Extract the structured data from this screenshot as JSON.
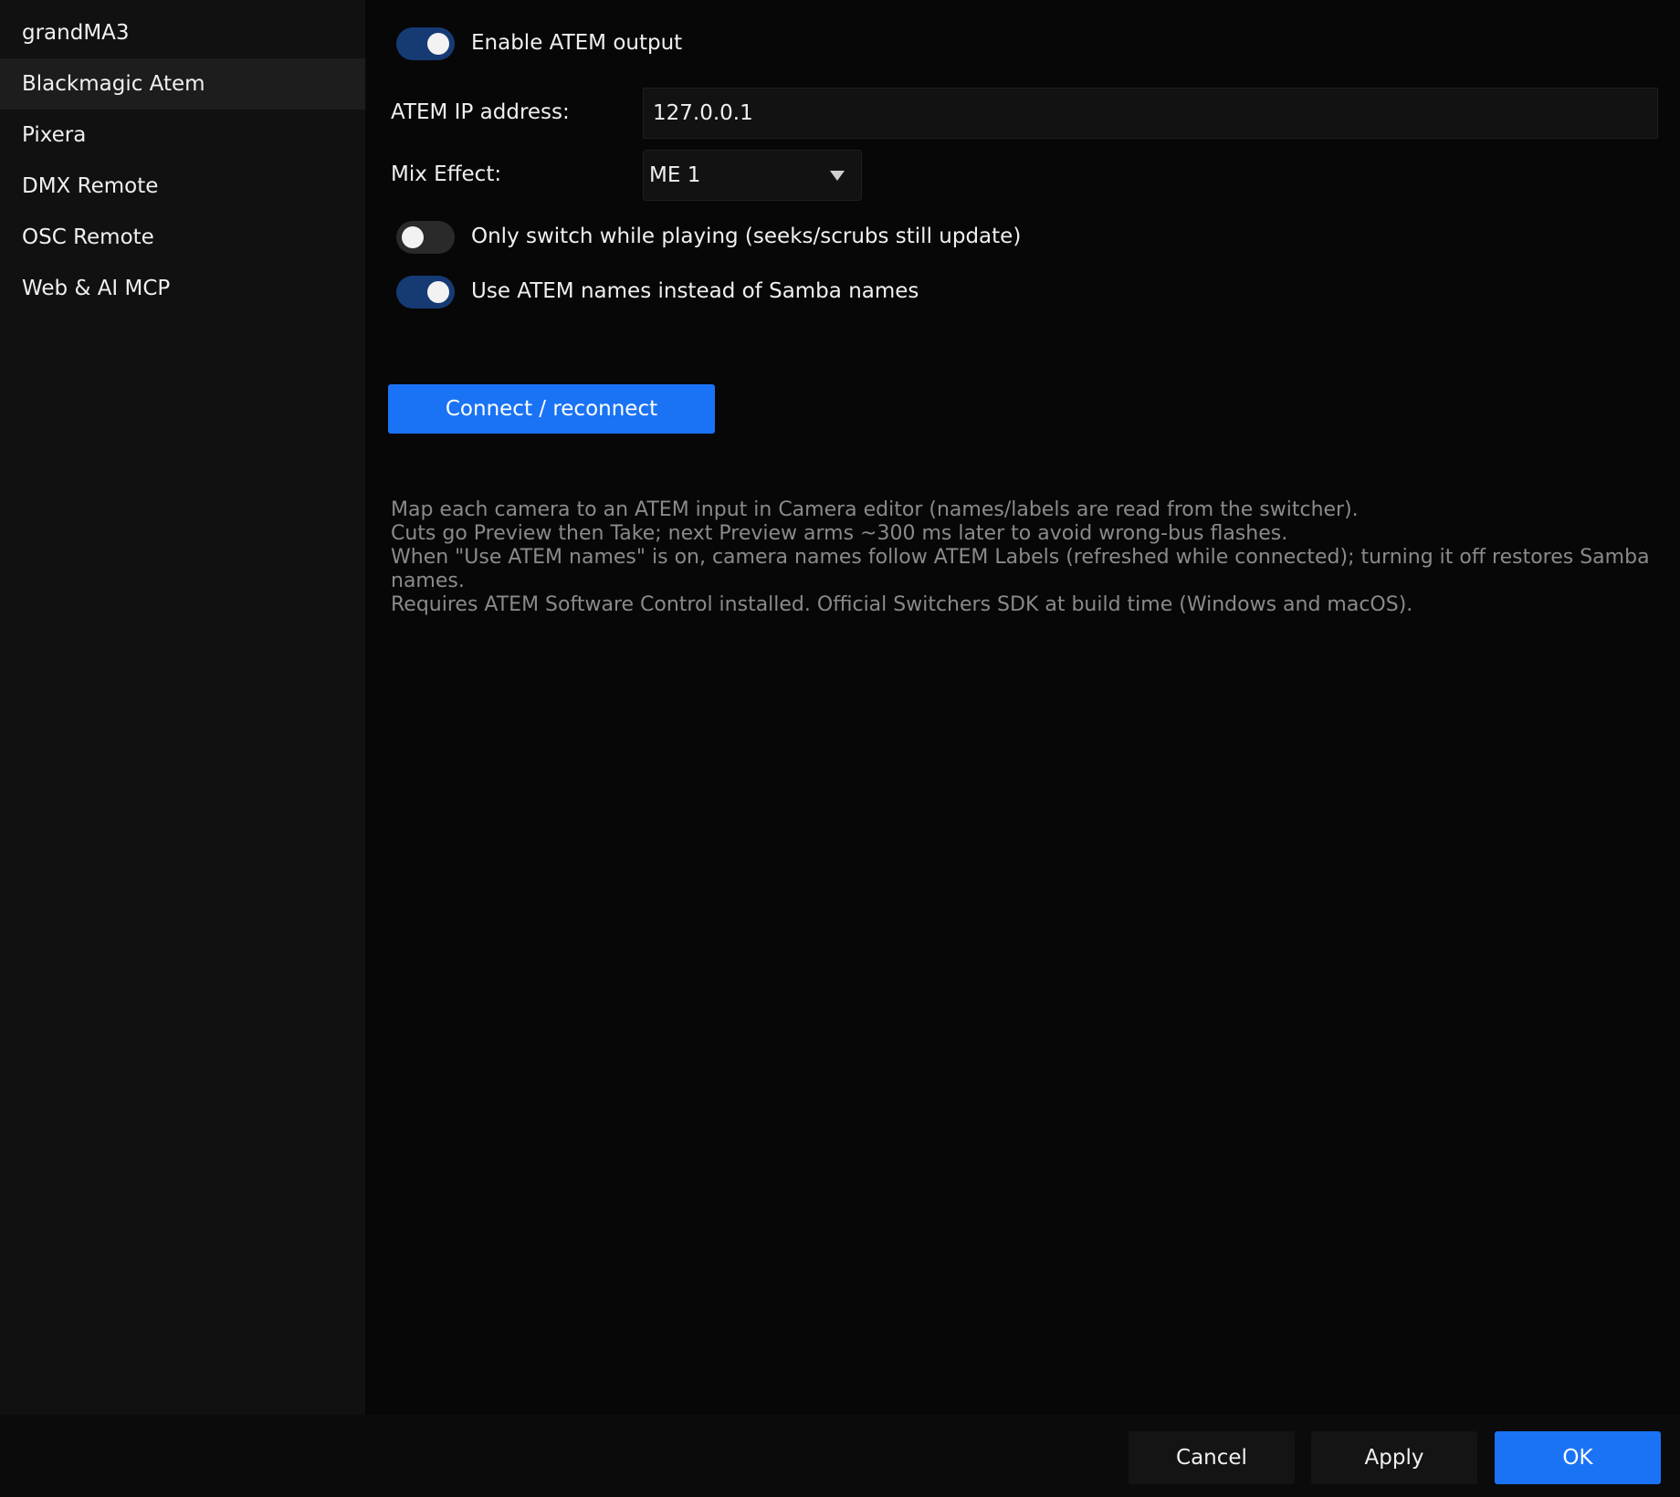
{
  "sidebar": {
    "items": [
      {
        "label": "grandMA3"
      },
      {
        "label": "Blackmagic Atem"
      },
      {
        "label": "Pixera"
      },
      {
        "label": "DMX Remote"
      },
      {
        "label": "OSC Remote"
      },
      {
        "label": "Web & AI MCP"
      }
    ],
    "active_index": 1
  },
  "main": {
    "enable_output": {
      "label": "Enable ATEM output",
      "checked": true
    },
    "ip": {
      "label": "ATEM IP address:",
      "value": "127.0.0.1"
    },
    "mix_effect": {
      "label": "Mix Effect:",
      "value": "ME 1"
    },
    "only_switch_playing": {
      "label": "Only switch while playing (seeks/scrubs still update)",
      "checked": false
    },
    "use_atem_names": {
      "label": "Use ATEM names instead of Samba names",
      "checked": true
    },
    "connect_button": "Connect / reconnect",
    "help_lines": [
      "Map each camera to an ATEM input in Camera editor (names/labels are read from the switcher).",
      "Cuts go Preview then Take; next Preview arms ~300 ms later to avoid wrong-bus flashes.",
      "When \"Use ATEM names\" is on, camera names follow ATEM Labels (refreshed while connected); turning it off restores Samba names.",
      "Requires ATEM Software Control installed. Official Switchers SDK at build time (Windows and macOS)."
    ]
  },
  "footer": {
    "cancel": "Cancel",
    "apply": "Apply",
    "ok": "OK"
  },
  "colors": {
    "accent": "#1a73f5",
    "toggle_on": "#163a73",
    "sidebar_bg": "#111111",
    "main_bg": "#070707",
    "help_text": "#8a8a8a"
  }
}
